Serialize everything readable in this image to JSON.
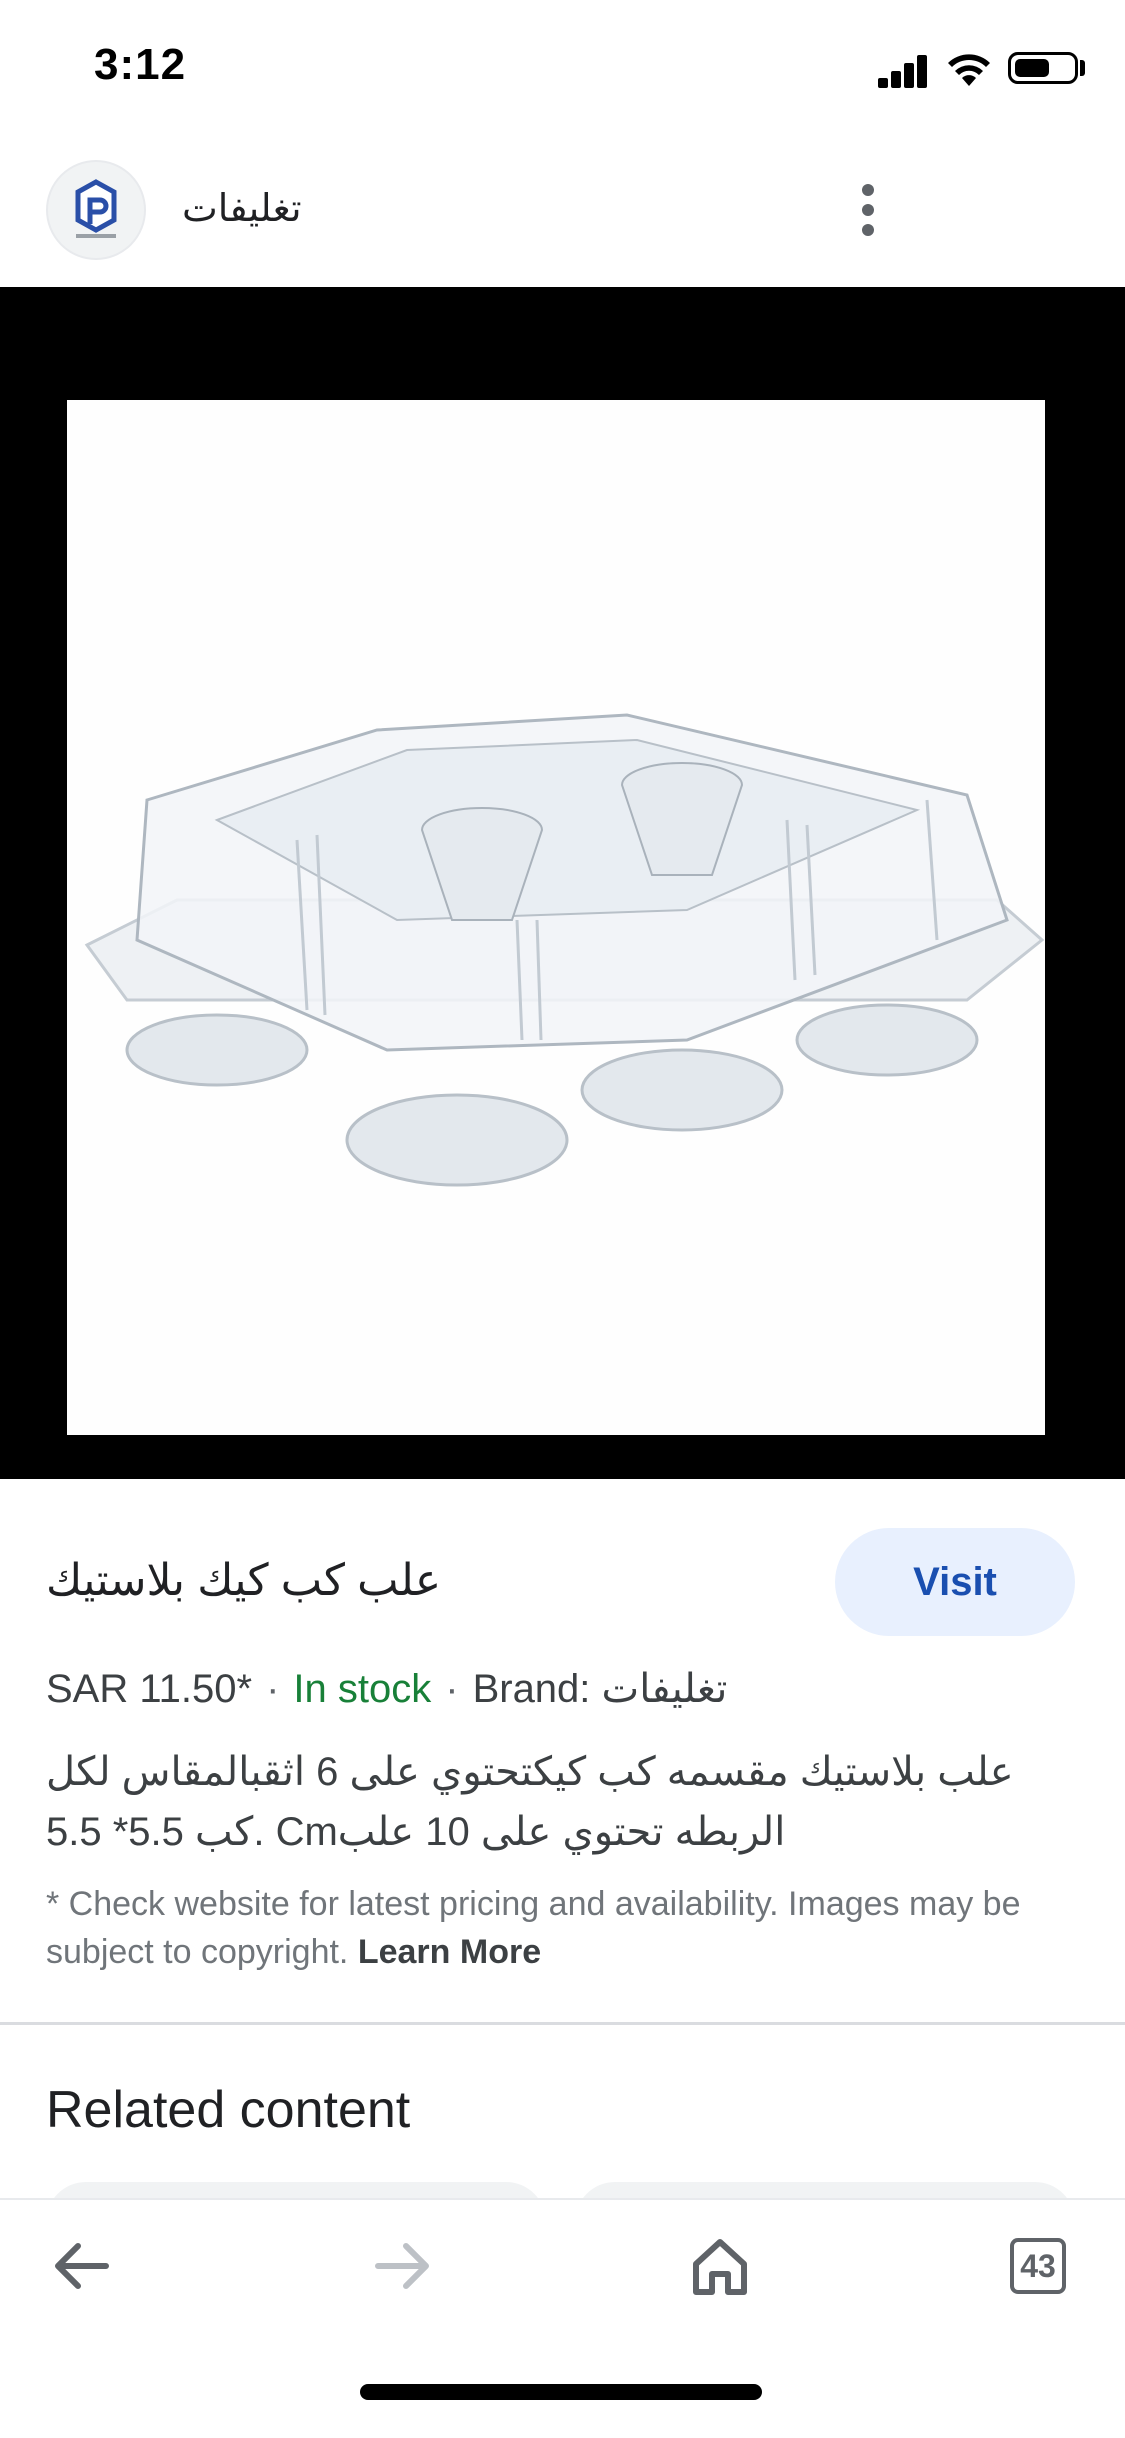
{
  "status_bar": {
    "time": "3:12",
    "icons": [
      "signal-icon",
      "wifi-icon",
      "battery-icon"
    ],
    "battery_level": 0.6
  },
  "header": {
    "site_name": "تغليفات",
    "avatar_icon": "site-logo-icon",
    "menu_icon": "more-vert-icon"
  },
  "product": {
    "image_description_icon": "cupcake-container-image",
    "title": "علب كب كيك بلاستيك",
    "visit_label": "Visit",
    "price": "SAR 11.50*",
    "stock": "In stock",
    "brand": "Brand: تغليفات",
    "description_line1": "علب بلاستيك مقسمه كب كيكتحتوي على 6 اثقبالمقاس لكل",
    "description_line2": "كب 5.5* 5.5. Cmالربطه تحتوي على 10 علب",
    "disclaimer": "* Check website for latest pricing and availability. Images may be subject to copyright.",
    "learn_more": "Learn More"
  },
  "related": {
    "title": "Related content"
  },
  "bottom_bar": {
    "back_icon": "back-arrow-icon",
    "forward_icon": "forward-arrow-icon",
    "home_icon": "home-icon",
    "tab_count": "43"
  },
  "colors": {
    "accent": "#1a4fb0",
    "visit_bg": "#e8f0fe",
    "in_stock": "#188038",
    "viewer_bg": "#000000"
  }
}
